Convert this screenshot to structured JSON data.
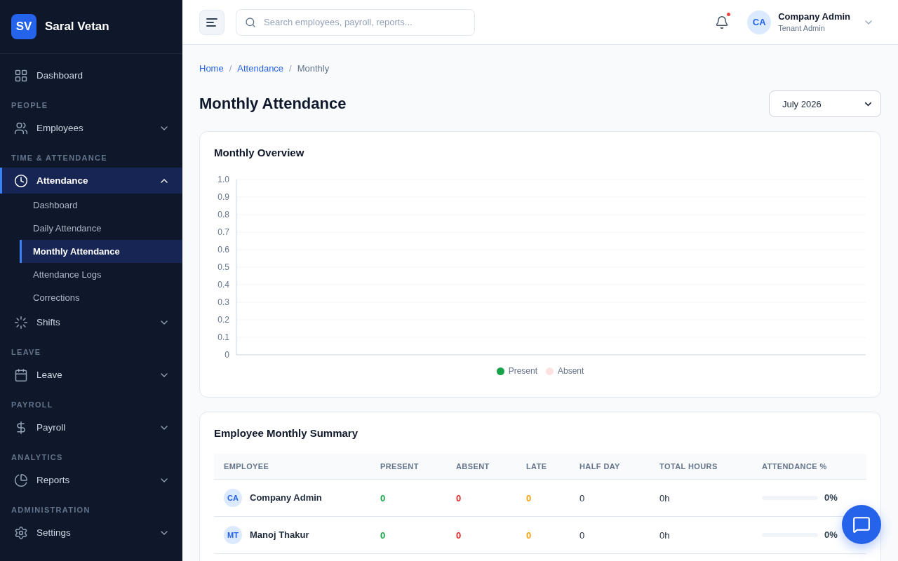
{
  "brand": {
    "initials": "SV",
    "name": "Saral Vetan"
  },
  "sidebar": {
    "sections": [
      {
        "items": [
          {
            "label": "Dashboard",
            "selected": false
          }
        ]
      },
      {
        "label": "PEOPLE",
        "items": [
          {
            "label": "Employees",
            "selected": false,
            "expanded": false
          }
        ]
      },
      {
        "label": "TIME & ATTENDANCE",
        "items": [
          {
            "label": "Attendance",
            "selected": true,
            "expanded": true,
            "children": [
              {
                "label": "Dashboard",
                "selected": false
              },
              {
                "label": "Daily Attendance",
                "selected": false
              },
              {
                "label": "Monthly Attendance",
                "selected": true
              },
              {
                "label": "Attendance Logs",
                "selected": false
              },
              {
                "label": "Corrections",
                "selected": false
              }
            ]
          },
          {
            "label": "Shifts",
            "selected": false,
            "expanded": false
          }
        ]
      },
      {
        "label": "LEAVE",
        "items": [
          {
            "label": "Leave",
            "selected": false,
            "expanded": false
          }
        ]
      },
      {
        "label": "PAYROLL",
        "items": [
          {
            "label": "Payroll",
            "selected": false,
            "expanded": false
          }
        ]
      },
      {
        "label": "ANALYTICS",
        "items": [
          {
            "label": "Reports",
            "selected": false,
            "expanded": false
          }
        ]
      },
      {
        "label": "ADMINISTRATION",
        "items": [
          {
            "label": "Settings",
            "selected": false,
            "expanded": false
          }
        ]
      }
    ]
  },
  "header": {
    "search": {
      "placeholder": "Search employees, payroll, reports..."
    },
    "notifications": {
      "unread": true
    },
    "user": {
      "initials": "CA",
      "name": "Company Admin",
      "role": "Tenant Admin"
    }
  },
  "breadcrumb": [
    {
      "label": "Home",
      "kind": "link"
    },
    {
      "label": "/",
      "kind": "separator"
    },
    {
      "label": "Attendance",
      "kind": "link"
    },
    {
      "label": "/",
      "kind": "separator"
    },
    {
      "label": "Monthly",
      "kind": "current"
    }
  ],
  "page_title": "Monthly Attendance",
  "month_select": {
    "value": "July 2026"
  },
  "overview": {
    "title": "Monthly Overview",
    "chart_data": {
      "type": "bar",
      "series": [
        {
          "name": "Present",
          "color": "#16a34a"
        },
        {
          "name": "Absent",
          "color": "#fee2e2"
        }
      ],
      "ylim": [
        0,
        1
      ],
      "yticks": [
        0,
        0.1,
        0.2,
        0.3,
        0.4,
        0.5,
        0.6,
        0.7,
        0.8,
        0.9,
        {
          "value": 1,
          "label": "1.0"
        }
      ],
      "grid": true
    }
  },
  "summary": {
    "title": "Employee Monthly Summary",
    "columns": [
      "EMPLOYEE",
      "PRESENT",
      "ABSENT",
      "LATE",
      "HALF DAY",
      "TOTAL HOURS",
      "ATTENDANCE %"
    ],
    "rows": [
      {
        "employee": {
          "initials": "CA",
          "name": "Company Admin"
        },
        "present": "0",
        "absent": "0",
        "late": "0",
        "half_day": "0",
        "total_hours": "0h",
        "attendance": {
          "level": 0,
          "reading": "0%"
        }
      },
      {
        "employee": {
          "initials": "MT",
          "name": "Manoj Thakur"
        },
        "present": "0",
        "absent": "0",
        "late": "0",
        "half_day": "0",
        "total_hours": "0h",
        "attendance": {
          "level": 0,
          "reading": "0%"
        }
      }
    ]
  }
}
